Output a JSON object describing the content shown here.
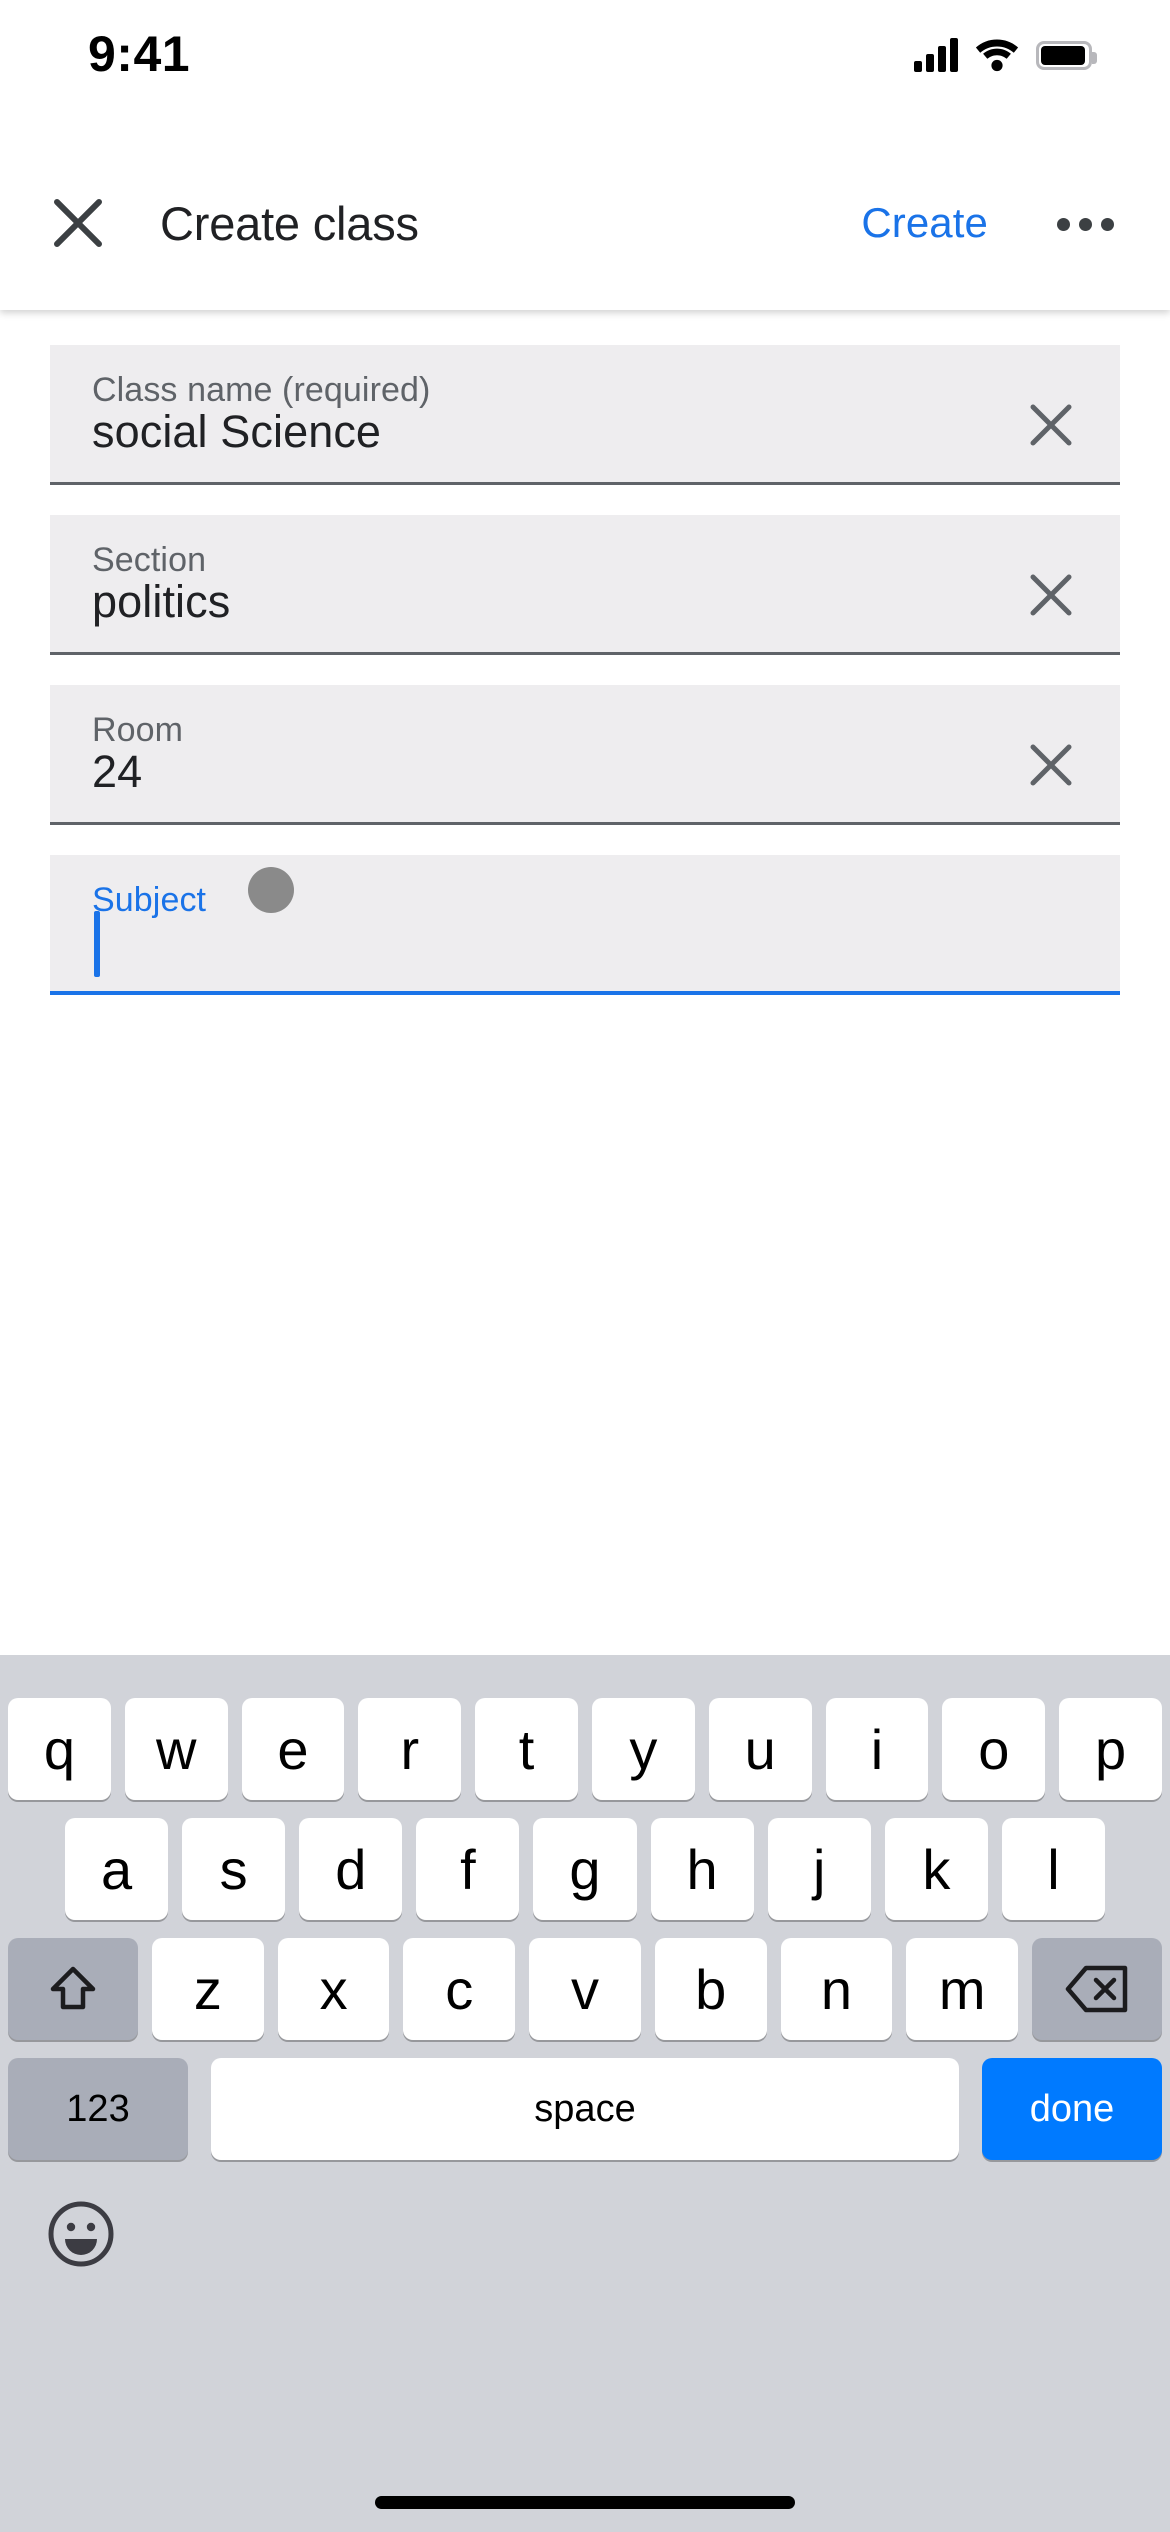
{
  "status_bar": {
    "time": "9:41",
    "signal_icon": "cellular-signal-icon",
    "wifi_icon": "wifi-icon",
    "battery_icon": "battery-full-icon"
  },
  "appbar": {
    "close_icon": "close-icon",
    "title": "Create class",
    "action_label": "Create",
    "overflow_icon": "overflow-menu-icon"
  },
  "form": {
    "fields": [
      {
        "name": "class-name",
        "label": "Class name (required)",
        "value": "social Science",
        "clear_icon": "clear-icon",
        "focused": false
      },
      {
        "name": "section",
        "label": "Section",
        "value": "politics",
        "clear_icon": "clear-icon",
        "focused": false
      },
      {
        "name": "room",
        "label": "Room",
        "value": "24",
        "clear_icon": "clear-icon",
        "focused": false
      },
      {
        "name": "subject",
        "label": "Subject",
        "value": "",
        "clear_icon": "",
        "focused": true
      }
    ]
  },
  "keyboard": {
    "row1": [
      "q",
      "w",
      "e",
      "r",
      "t",
      "y",
      "u",
      "i",
      "o",
      "p"
    ],
    "row2": [
      "a",
      "s",
      "d",
      "f",
      "g",
      "h",
      "j",
      "k",
      "l"
    ],
    "row3": [
      "z",
      "x",
      "c",
      "v",
      "b",
      "n",
      "m"
    ],
    "shift_icon": "shift-icon",
    "backspace_icon": "backspace-icon",
    "numbers_label": "123",
    "space_label": "space",
    "done_label": "done",
    "emoji_icon": "emoji-icon"
  },
  "colors": {
    "accent_blue": "#1a73e8",
    "done_key_blue": "#007aff",
    "field_background": "#eeedef",
    "keyboard_background": "#d1d3d9",
    "modifier_key": "#a9adb8"
  }
}
